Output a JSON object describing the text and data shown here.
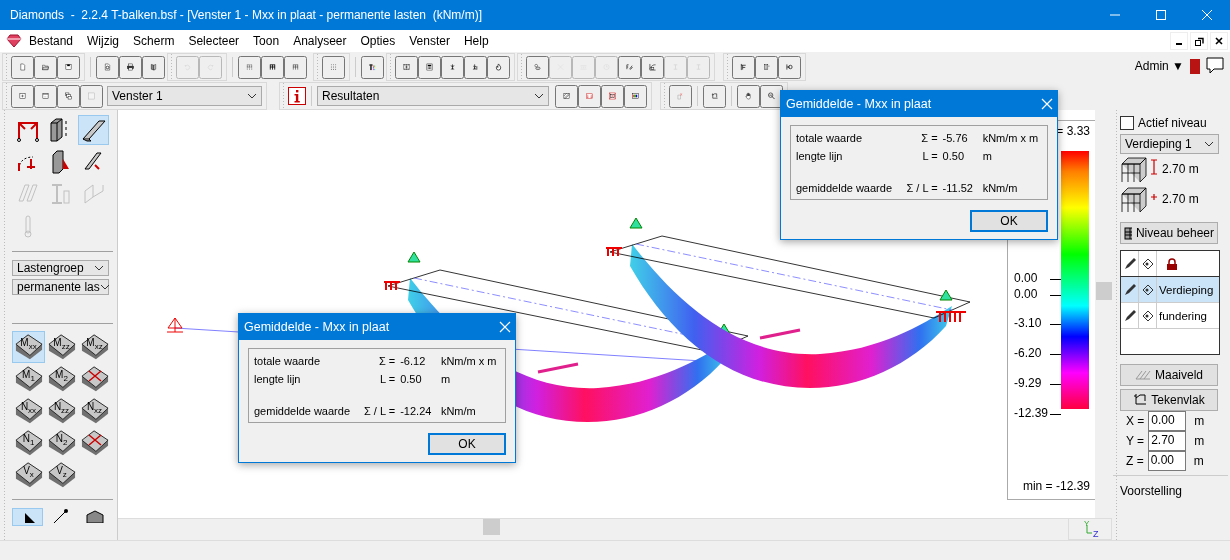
{
  "window": {
    "title": "Diamonds  -  2.2.4 T-balken.bsf - [Venster 1 - Mxx in plaat - permanente lasten  (kNm/m)]"
  },
  "menu": [
    "Bestand",
    "Wijzig",
    "Scherm",
    "Selecteer",
    "Toon",
    "Analyseer",
    "Opties",
    "Venster",
    "Help"
  ],
  "user": {
    "name": "Admin",
    "caret": "▼"
  },
  "toolbar_1": [
    [
      {
        "disabled": false
      },
      {
        "disabled": false
      },
      {
        "disabled": false
      }
    ],
    [
      {
        "disabled": false
      },
      {
        "disabled": false
      },
      {
        "disabled": false
      }
    ],
    [
      {
        "disabled": true
      },
      {
        "disabled": true
      }
    ],
    [
      {
        "disabled": false
      },
      {
        "disabled": false
      },
      {
        "disabled": false
      }
    ],
    [
      {
        "disabled": false
      }
    ],
    [
      {
        "disabled": false
      }
    ],
    [
      {
        "disabled": false
      },
      {
        "disabled": false
      },
      {
        "disabled": false
      },
      {
        "disabled": false
      },
      {
        "disabled": false
      }
    ],
    [
      {
        "disabled": false
      },
      {
        "disabled": true
      },
      {
        "disabled": true
      },
      {
        "disabled": true
      },
      {
        "disabled": false
      },
      {
        "disabled": false
      },
      {
        "disabled": true
      },
      {
        "disabled": true
      }
    ],
    [
      {
        "disabled": false
      },
      {
        "disabled": false
      },
      {
        "disabled": false
      }
    ]
  ],
  "toolbar_2": {
    "window_select": "Venster 1",
    "result_select": "Resultaten"
  },
  "left_panel": {
    "tools": [
      {
        "selected": false,
        "disabled": false
      },
      {
        "selected": false,
        "disabled": false
      },
      {
        "selected": true,
        "disabled": false
      },
      {
        "selected": false,
        "disabled": false
      },
      {
        "selected": false,
        "disabled": false
      },
      {
        "selected": false,
        "disabled": false
      },
      {
        "selected": false,
        "disabled": true
      },
      {
        "selected": false,
        "disabled": true
      },
      {
        "selected": false,
        "disabled": true
      },
      {
        "selected": false,
        "disabled": true
      }
    ],
    "load_group_select": "Lastengroep",
    "load_case_select": "permanente las",
    "result_types": [
      {
        "label": "M$_{xx}$",
        "selected": true
      },
      {
        "label": "M$_{zz}$",
        "selected": false
      },
      {
        "label": "M$_{xz}$",
        "selected": false
      },
      {
        "label": "M$_{1}$",
        "selected": false
      },
      {
        "label": "M$_{2}$",
        "selected": false
      },
      {
        "selected": false
      },
      {
        "label": "N$_{xx}$",
        "selected": false
      },
      {
        "label": "N$_{zz}$",
        "selected": false
      },
      {
        "label": "N$_{xz}$",
        "selected": false
      },
      {
        "label": "N$_{1}$",
        "selected": false
      },
      {
        "label": "N$_{2}$",
        "selected": false
      },
      {
        "selected": false
      },
      {
        "label": "V$_{x}$",
        "selected": false
      },
      {
        "label": "V$_{z}$",
        "selected": false
      }
    ],
    "bottom_tools": [
      {
        "selected": true
      },
      {
        "selected": false
      },
      {
        "selected": false
      }
    ]
  },
  "legend": {
    "max": "= 3.33",
    "ticks": [
      "0.00",
      "0.00",
      "-3.10",
      "-6.20",
      "-9.29",
      "-12.39"
    ],
    "min": "min = -12.39"
  },
  "axes": {
    "y": "Y",
    "z": "Z"
  },
  "dialogs": [
    {
      "title": "Gemiddelde - Mxx in plaat",
      "rows": [
        {
          "label": "totale waarde",
          "symbol": "Σ =",
          "value": "-6.12",
          "unit": "kNm/m x m"
        },
        {
          "label": "lengte lijn",
          "symbol": "L =",
          "value": "0.50",
          "unit": "m"
        },
        {
          "label": "gemiddelde waarde",
          "symbol": "Σ / L =",
          "value": "-12.24",
          "unit": "kNm/m"
        }
      ],
      "button": "OK"
    },
    {
      "title": "Gemiddelde - Mxx in plaat",
      "rows": [
        {
          "label": "totale waarde",
          "symbol": "Σ =",
          "value": "-5.76",
          "unit": "kNm/m x m"
        },
        {
          "label": "lengte lijn",
          "symbol": "L =",
          "value": "0.50",
          "unit": "m"
        },
        {
          "label": "gemiddelde waarde",
          "symbol": "Σ / L =",
          "value": "-11.52",
          "unit": "kNm/m"
        }
      ],
      "button": "OK"
    }
  ],
  "right_panel": {
    "active_level": {
      "label": "Actief niveau",
      "checked": false
    },
    "level_select": "Verdieping 1",
    "heights": [
      "2.70 m",
      "2.70 m"
    ],
    "manage_button": "Niveau beheer",
    "layers": [
      {
        "name": "Verdieping",
        "selected": true
      },
      {
        "name": "fundering",
        "selected": false
      }
    ],
    "ground_button": "Maaiveld",
    "plane_button": "Tekenvlak",
    "coordinates": [
      {
        "axis": "X =",
        "value": "0.00",
        "unit": "m"
      },
      {
        "axis": "Y =",
        "value": "2.70",
        "unit": "m"
      },
      {
        "axis": "Z =",
        "value": "0.00",
        "unit": "m"
      }
    ],
    "display_label": "Voorstelling"
  }
}
